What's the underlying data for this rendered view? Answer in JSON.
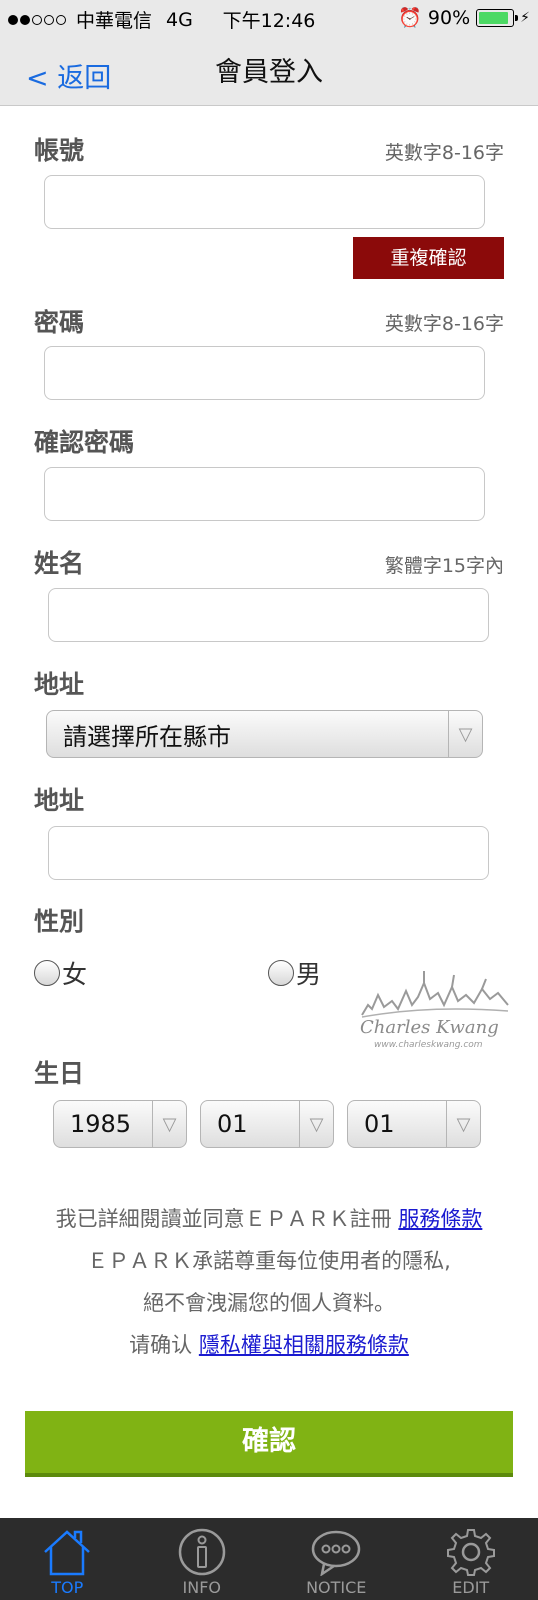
{
  "status_bar": {
    "carrier": "中華電信",
    "network": "4G",
    "time": "下午12:46",
    "battery": "90%"
  },
  "nav": {
    "back_label": "< 返回",
    "title": "會員登入"
  },
  "form": {
    "account": {
      "label": "帳號",
      "hint": "英數字8-16字",
      "value": ""
    },
    "check_duplicate_label": "重複確認",
    "password": {
      "label": "密碼",
      "hint": "英數字8-16字",
      "value": ""
    },
    "confirm_password": {
      "label": "確認密碼",
      "value": ""
    },
    "name": {
      "label": "姓名",
      "hint": "繁體字15字內",
      "value": ""
    },
    "city": {
      "label": "地址",
      "selected": "請選擇所在縣市"
    },
    "address": {
      "label": "地址",
      "value": ""
    },
    "gender": {
      "label": "性別",
      "female": "女",
      "male": "男"
    },
    "birthday": {
      "label": "生日",
      "year": "1985",
      "month": "01",
      "day": "01"
    }
  },
  "watermark": {
    "text": "Charles Kwang",
    "url": "www.charleskwang.com"
  },
  "agreement": {
    "line1_text": "我已詳細閱讀並同意ＥＰＡＲＫ註冊",
    "terms_link": "服務條款",
    "line2": "ＥＰＡＲＫ承諾尊重每位使用者的隱私,",
    "line3": "絕不會洩漏您的個人資料。",
    "line4_text": "请确认",
    "privacy_link": "隱私權與相關服務條款"
  },
  "submit_label": "確認",
  "tabs": [
    {
      "label": "TOP",
      "icon": "home-icon",
      "active": true
    },
    {
      "label": "INFO",
      "icon": "info-icon",
      "active": false
    },
    {
      "label": "NOTICE",
      "icon": "chat-bubble-icon",
      "active": false
    },
    {
      "label": "EDIT",
      "icon": "gear-icon",
      "active": false
    }
  ],
  "colors": {
    "accent_blue": "#1a6be0",
    "dup_button": "#8b0a0a",
    "submit_green": "#80b314",
    "tab_active": "#1a7bff"
  }
}
